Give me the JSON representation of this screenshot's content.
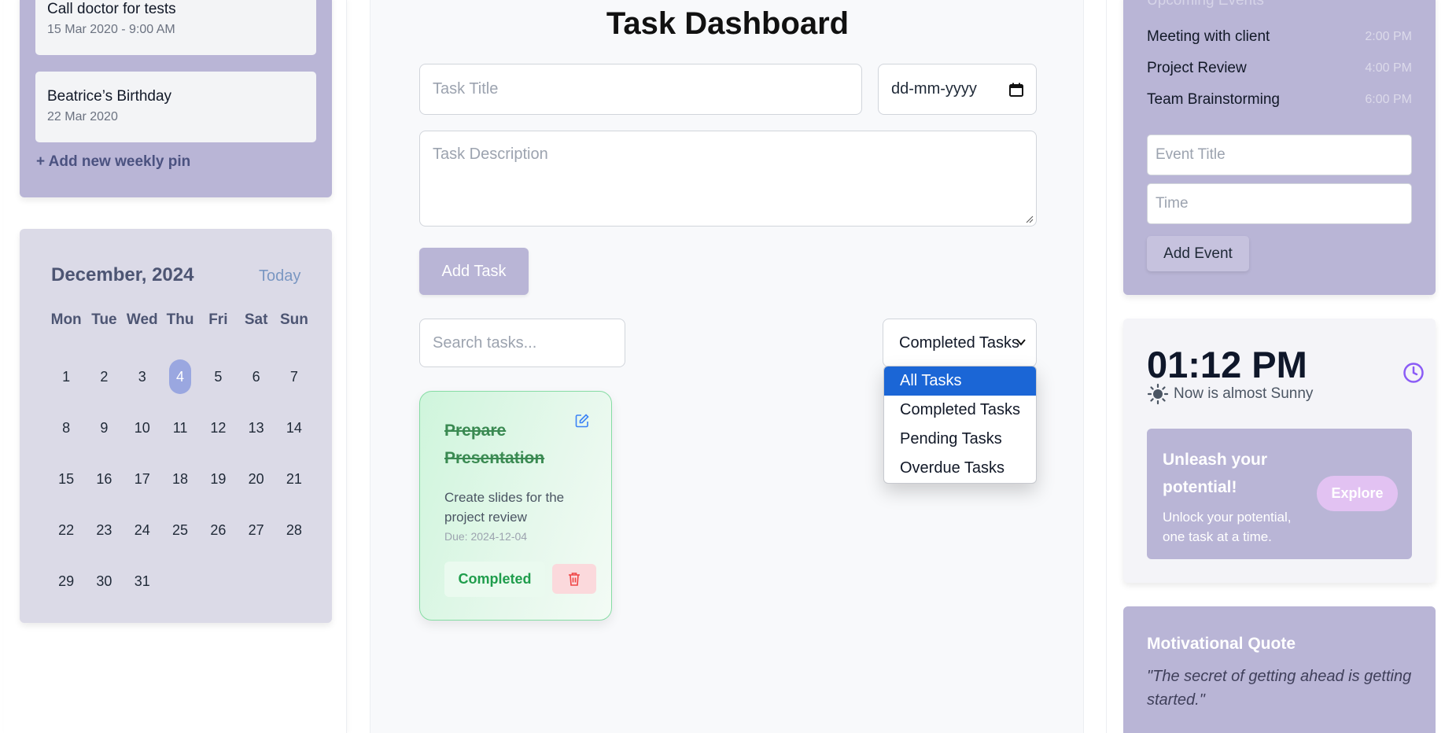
{
  "pins": {
    "items": [
      {
        "title": "Call doctor for tests",
        "date": "15 Mar 2020 - 9:00 AM"
      },
      {
        "title": "Beatrice’s Birthday",
        "date": "22 Mar 2020"
      }
    ],
    "add_label": "+ Add new weekly pin"
  },
  "calendar": {
    "month": "December, 2024",
    "today_label": "Today",
    "weekdays": [
      "Mon",
      "Tue",
      "Wed",
      "Thu",
      "Fri",
      "Sat",
      "Sun"
    ],
    "days": [
      "1",
      "2",
      "3",
      "4",
      "5",
      "6",
      "7",
      "8",
      "9",
      "10",
      "11",
      "12",
      "13",
      "14",
      "15",
      "16",
      "17",
      "18",
      "19",
      "20",
      "21",
      "22",
      "23",
      "24",
      "25",
      "26",
      "27",
      "28",
      "29",
      "30",
      "31"
    ],
    "selected_day": "4"
  },
  "dashboard": {
    "title": "Task Dashboard",
    "task_title_placeholder": "Task Title",
    "date_value": "dd-mm-yyyy",
    "description_placeholder": "Task Description",
    "add_task_label": "Add Task",
    "search_placeholder": "Search tasks...",
    "filter_selected": "Completed Tasks",
    "filter_options": [
      "All Tasks",
      "Completed Tasks",
      "Pending Tasks",
      "Overdue Tasks"
    ],
    "filter_highlighted": "All Tasks"
  },
  "tasks": [
    {
      "title": "Prepare Presentation",
      "description": "Create slides for the project review",
      "due": "Due: 2024-12-04",
      "status_label": "Completed"
    }
  ],
  "events": {
    "heading": "Upcoming Events",
    "items": [
      {
        "name": "Meeting with client",
        "time": "2:00 PM"
      },
      {
        "name": "Project Review",
        "time": "4:00 PM"
      },
      {
        "name": "Team Brainstorming",
        "time": "6:00 PM"
      }
    ],
    "title_placeholder": "Event Title",
    "time_placeholder": "Time",
    "add_label": "Add Event"
  },
  "clock": {
    "time": "01:12 PM",
    "weather": "Now is almost Sunny"
  },
  "promo": {
    "title": "Unleash your potential!",
    "subtitle": "Unlock your potential, one task at a time.",
    "button_label": "Explore"
  },
  "quote": {
    "title": "Motivational Quote",
    "text": "\"The secret of getting ahead is getting started.\""
  },
  "colors": {
    "accent": "#b9b5d6",
    "calendar_bg": "#dbdae7",
    "selected_day": "#9aa7e0",
    "completed_green": "#1f9d4c",
    "dropdown_highlight": "#1b66d6",
    "clock_icon": "#8b5cf6"
  },
  "icons": [
    "edit-icon",
    "trash-icon",
    "calendar-icon",
    "chevron-down-icon",
    "sun-icon",
    "clock-icon"
  ]
}
